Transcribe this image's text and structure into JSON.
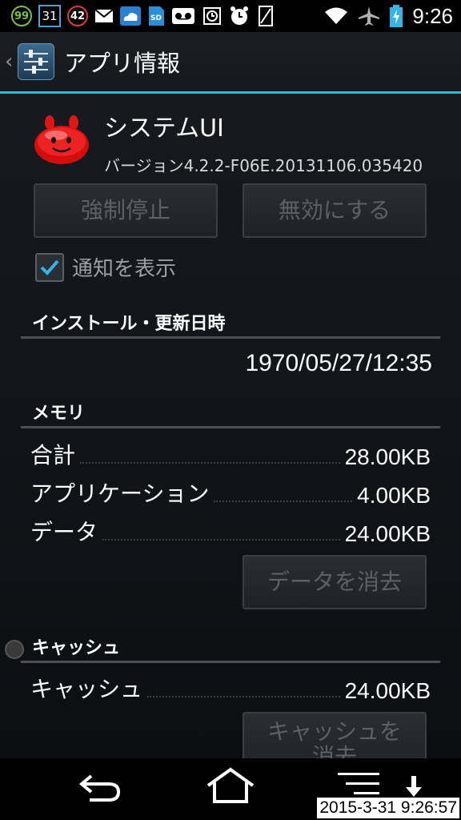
{
  "status_bar": {
    "notif_badge_1": "99",
    "calendar_day": "31",
    "notif_badge_2": "42",
    "sd_label": "SD",
    "time": "9:26",
    "icons": [
      "badge-99-icon",
      "calendar-icon",
      "badge-42-icon",
      "mail-icon",
      "cloud-icon",
      "sd-card-icon",
      "voicemail-icon",
      "alarm-badge-icon",
      "alarm-clock-icon",
      "vibrate-icon",
      "wifi-icon",
      "airplane-icon",
      "battery-charging-icon"
    ]
  },
  "action_bar": {
    "title": "アプリ情報"
  },
  "app": {
    "name": "システムUI",
    "version": "バージョン4.2.2-F06E.20131106.035420"
  },
  "buttons": {
    "force_stop": "強制停止",
    "disable": "無効にする",
    "clear_data": "データを消去",
    "clear_cache": "キャッシュを消去"
  },
  "notification_toggle": {
    "label": "通知を表示",
    "checked": true
  },
  "sections": {
    "install": "インストール・更新日時",
    "memory": "メモリ",
    "cache": "キャッシュ"
  },
  "install_datetime": "1970/05/27/12:35",
  "memory_rows": [
    {
      "label": "合計",
      "value": "28.00KB"
    },
    {
      "label": "アプリケーション",
      "value": "4.00KB"
    },
    {
      "label": "データ",
      "value": "24.00KB"
    }
  ],
  "cache_row": {
    "label": "キャッシュ",
    "value": "24.00KB"
  },
  "screenshot_timestamp": "2015-3-31 9:26:57",
  "colors": {
    "accent": "#33b5e5",
    "check": "#33b5e5",
    "background": "#0b0d10"
  }
}
